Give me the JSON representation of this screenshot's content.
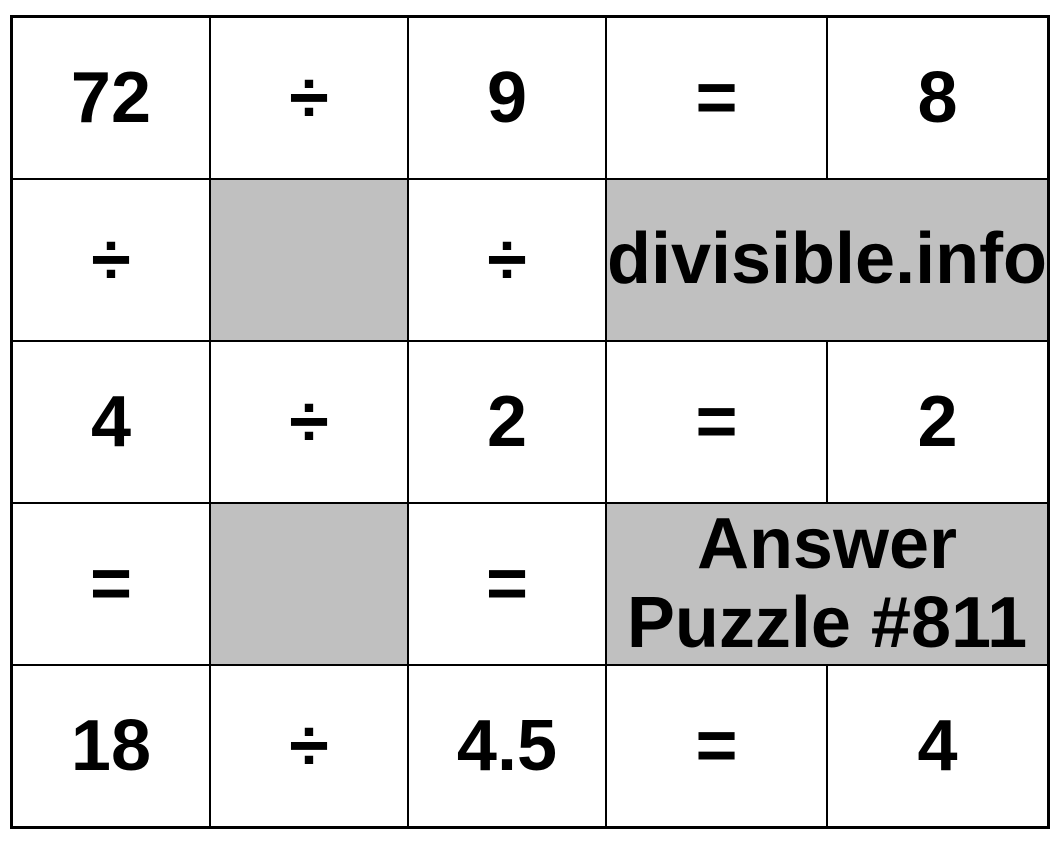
{
  "colors": {
    "highlight": "#008000",
    "shaded": "#c0c0c0"
  },
  "site_label": "divisible.info",
  "answer_label": "Answer Puzzle #811",
  "grid": {
    "r0": {
      "c0": "72",
      "c1": "÷",
      "c2": "9",
      "c3": "=",
      "c4": "8"
    },
    "r1": {
      "c0": "÷",
      "c1": "",
      "c2": "÷"
    },
    "r2": {
      "c0": "4",
      "c1": "÷",
      "c2": "2",
      "c3": "=",
      "c4": "2"
    },
    "r3": {
      "c0": "=",
      "c1": "",
      "c2": "="
    },
    "r4": {
      "c0": "18",
      "c1": "÷",
      "c2": "4.5",
      "c3": "=",
      "c4": "4"
    }
  }
}
